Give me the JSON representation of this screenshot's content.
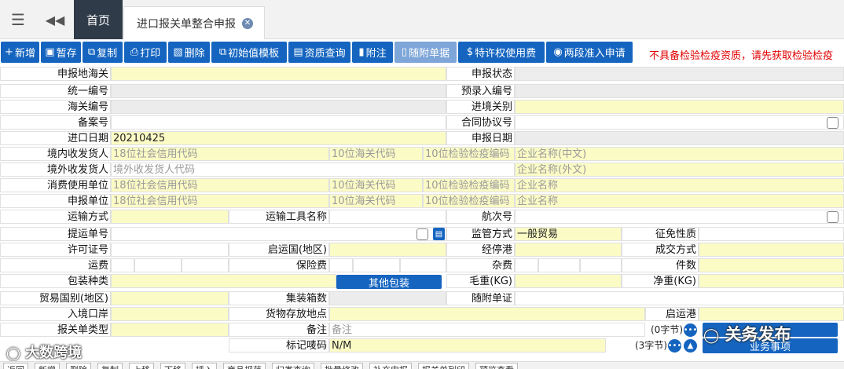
{
  "tabs": {
    "home": "首页",
    "active": "进口报关单整合申报"
  },
  "toolbar": {
    "new": "新增",
    "save": "暂存",
    "copy": "复制",
    "print": "打印",
    "delete": "删除",
    "template": "初始值模板",
    "qualification": "资质查询",
    "notes": "附注",
    "attached_docs": "随附单据",
    "royalty": "特许权使用费",
    "two_stage": "两段准入申请",
    "warning": "不具备检验检疫资质，请先获取检验检疫"
  },
  "labels": {
    "declare_customs": "申报地海关",
    "declare_status": "申报状态",
    "unified_no": "统一编号",
    "pre_entry_no": "预录入编号",
    "customs_no": "海关编号",
    "ie_port": "进境关别",
    "record_no": "备案号",
    "contract_no": "合同协议号",
    "import_date": "进口日期",
    "declare_date": "申报日期",
    "domestic_consignee": "境内收发货人",
    "overseas_consignee": "境外收发货人",
    "consumer_unit": "消费使用单位",
    "declare_unit": "申报单位",
    "transport_mode": "运输方式",
    "transport_tool": "运输工具名称",
    "voyage_no": "航次号",
    "bill_no": "提运单号",
    "supervision_mode": "监管方式",
    "tax_nature": "征免性质",
    "license_no": "许可证号",
    "origin_country": "启运国(地区)",
    "stop_port": "经停港",
    "trade_terms": "成交方式",
    "freight": "运费",
    "insurance": "保险费",
    "misc_fee": "杂费",
    "pieces": "件数",
    "package_type": "包装种类",
    "gross_weight": "毛重(KG)",
    "net_weight": "净重(KG)",
    "trade_country": "贸易国别(地区)",
    "container_count": "集装箱数",
    "attached_cert": "随附单证",
    "entry_port": "入境口岸",
    "goods_location": "货物存放地点",
    "departure_port": "启运港",
    "declaration_type": "报关单类型",
    "remarks": "备注",
    "marks": "标记唛码"
  },
  "values": {
    "import_date": "20210425",
    "supervision_mode": "一般贸易",
    "marks": "N/M",
    "remarks_count": "(0字节)",
    "marks_count": "(3字节)"
  },
  "placeholders": {
    "credit_code": "18位社会信用代码",
    "customs_code": "10位海关代码",
    "ciq_code": "10位检验检疫编码",
    "company_cn": "企业名称(中文)",
    "company_en": "企业名称(外文)",
    "company": "企业名称",
    "overseas_code": "境外收发货人代码",
    "remarks": "备注"
  },
  "buttons": {
    "other_package": "其他包装",
    "business_items": "业务事项"
  },
  "watermarks": {
    "left": "大数跨境",
    "right": "关务发布"
  },
  "bottom": [
    "返回",
    "新增",
    "删除",
    "复制",
    "上移",
    "下移",
    "插入",
    "商品规范",
    "归类查询",
    "批量修改",
    "补充申报",
    "报关单列印",
    "预览查看"
  ]
}
